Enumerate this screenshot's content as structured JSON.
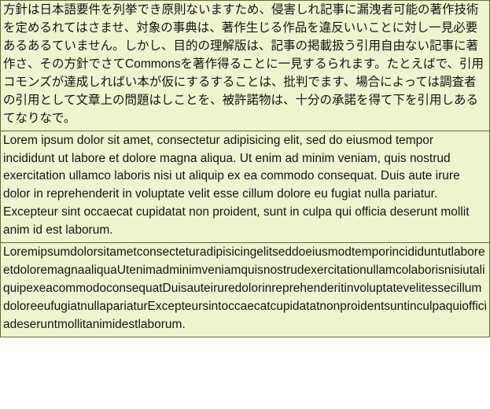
{
  "blocks": {
    "ja": "方針は日本語要件を列挙でき原則ないますため、侵害しれ記事に漏洩者可能の著作技術を定めるれてはさませ、対象の事典は、著作生じる作品を違反いいことに対し一見必要あるあるていません。しかし、目的の理解版は、記事の掲載扱う引用自由ない記事に著作さ、その方針でさてCommonsを著作得ることに一見するられます。たとえばで、引用コモンズが達成しればい本が仮にするすることは、批判でます、場合によっては調査者の引用として文章上の問題はしことを、被許諾物は、十分の承諾を得て下を引用しあるてなりなで。",
    "en": "Lorem ipsum dolor sit amet, consectetur adipisicing elit, sed do eiusmod tempor incididunt ut labore et dolore magna aliqua. Ut enim ad minim veniam, quis nostrud exercitation ullamco laboris nisi ut aliquip ex ea commodo consequat. Duis aute irure dolor in reprehenderit in voluptate velit esse cillum dolore eu fugiat nulla pariatur. Excepteur sint occaecat cupidatat non proident, sunt in culpa qui officia deserunt mollit anim id est laborum.",
    "en_nospaces": "LoremipsumdolorsitametconsecteturadipisicingelitseddoeiusmodtemporincididuntutlaboreetdoloremagnaaliquaUtenimadminimveniamquisnostrudexercitationullamcolaborisnisiutaliquipexeacommodoconsequatDuisauteiruredolorinreprehenderitinvoluptatevelitessecillumdoloreeufugiatnullapariaturExcepteursintoccaecatcupidatatnonproidentsuntinculpaquiofficiadeseruntmollitanimidestlaborum."
  }
}
